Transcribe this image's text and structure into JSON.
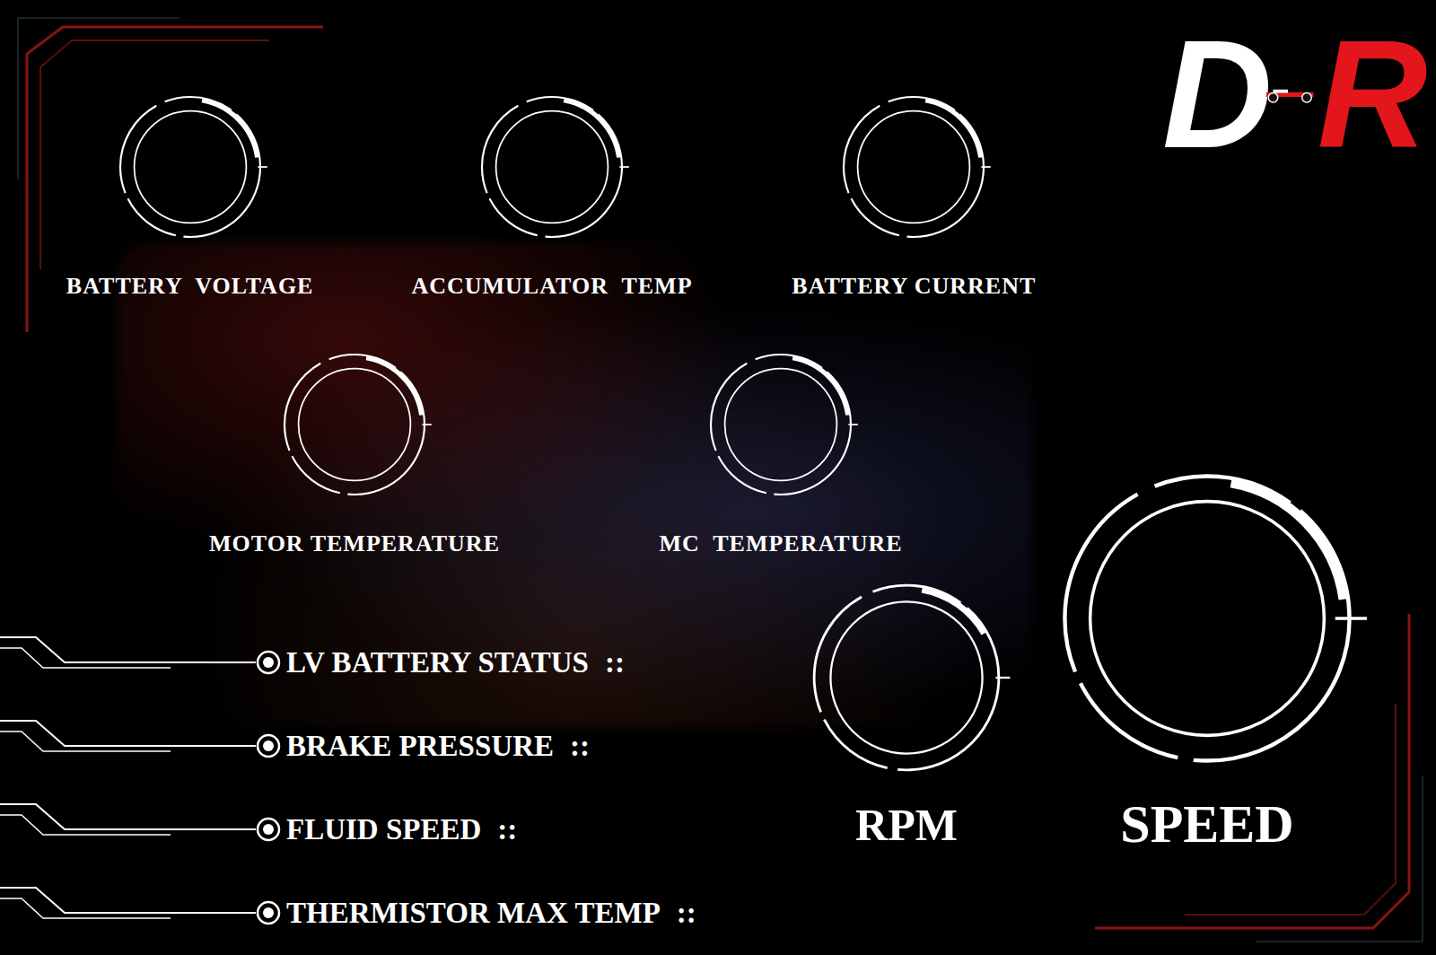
{
  "logo": {
    "letters": [
      {
        "text": "D",
        "color": "#ffffff"
      },
      {
        "text": "R",
        "color": "#e3161b"
      }
    ]
  },
  "top_gauges": [
    {
      "label": "BATTERY  VOLTAGE",
      "level": 0.2
    },
    {
      "label": "ACCUMULATOR  TEMP",
      "level": 0.2
    },
    {
      "label": "BATTERY CURRENT",
      "level": 0.2
    }
  ],
  "mid_gauges": [
    {
      "label": "MOTOR TEMPERATURE",
      "level": 0.2
    },
    {
      "label": "MC  TEMPERATURE",
      "level": 0.2
    }
  ],
  "status_items": [
    {
      "label": "LV BATTERY STATUS",
      "separator": "::"
    },
    {
      "label": "BRAKE PRESSURE",
      "separator": "::"
    },
    {
      "label": "FLUID SPEED",
      "separator": "::"
    },
    {
      "label": "THERMISTOR MAX TEMP",
      "separator": "::"
    }
  ],
  "main_gauges": [
    {
      "label": "RPM",
      "level": 0.14
    },
    {
      "label": "SPEED",
      "level": 0.2
    }
  ]
}
